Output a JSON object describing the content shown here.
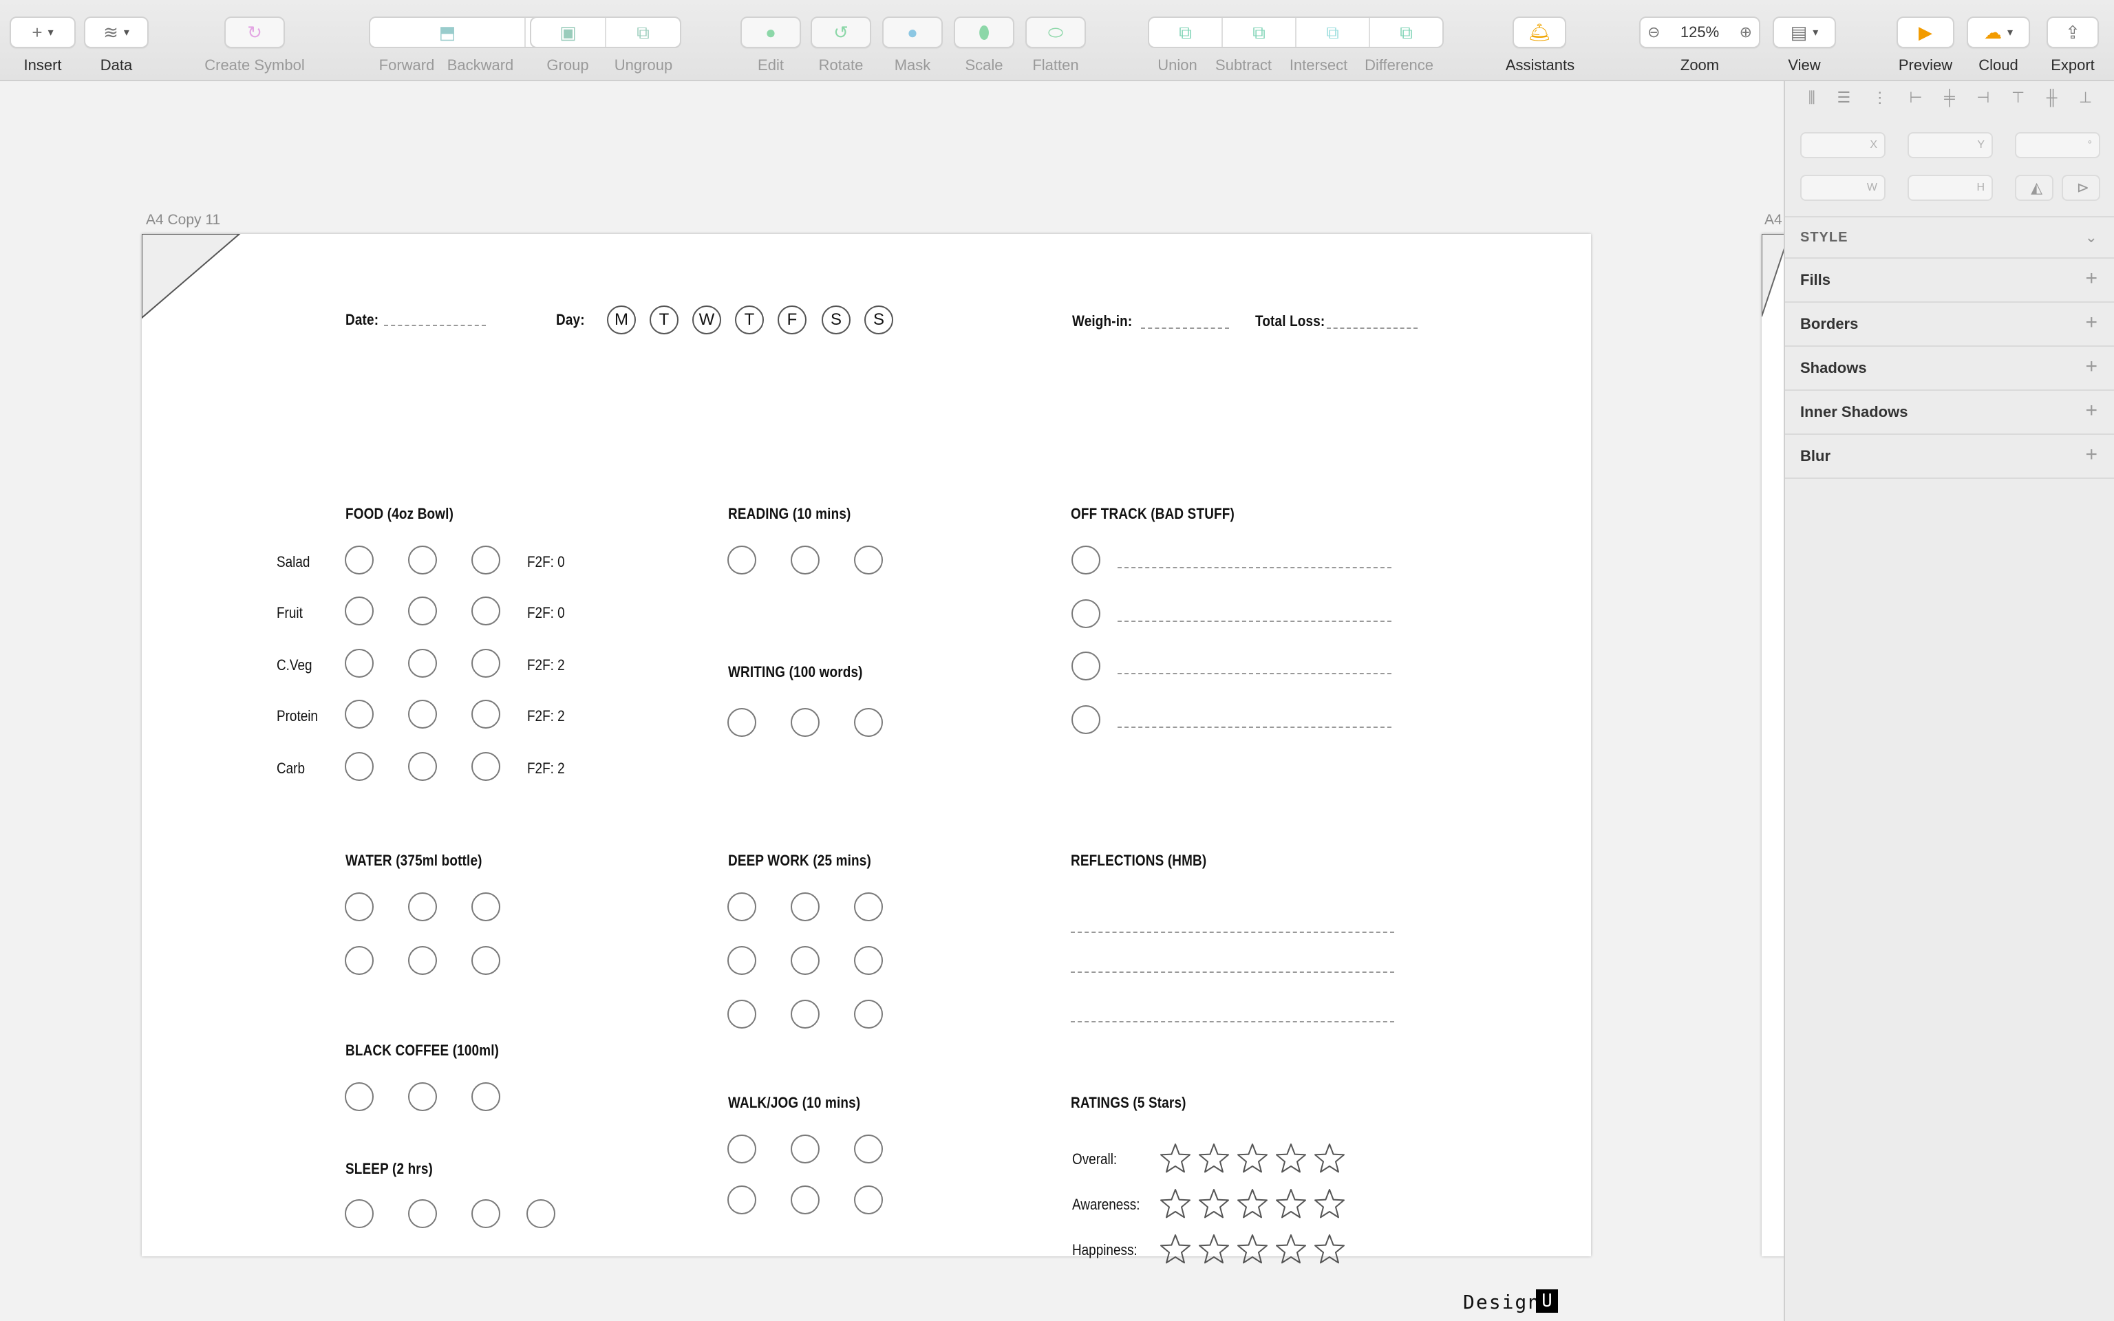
{
  "toolbar": {
    "insert": "Insert",
    "data": "Data",
    "create_symbol": "Create Symbol",
    "forward": "Forward",
    "backward": "Backward",
    "group": "Group",
    "ungroup": "Ungroup",
    "edit": "Edit",
    "rotate": "Rotate",
    "mask": "Mask",
    "scale": "Scale",
    "flatten": "Flatten",
    "union": "Union",
    "subtract": "Subtract",
    "intersect": "Intersect",
    "difference": "Difference",
    "assistants": "Assistants",
    "zoom_value": "125%",
    "zoom": "Zoom",
    "view": "View",
    "preview": "Preview",
    "cloud": "Cloud",
    "export": "Export"
  },
  "canvas": {
    "artboard_label": "A4 Copy 11",
    "artboard2_label": "A4"
  },
  "planner": {
    "date_label": "Date:",
    "day_label": "Day:",
    "days": [
      "M",
      "T",
      "W",
      "T",
      "F",
      "S",
      "S"
    ],
    "weigh_in_label": "Weigh-in:",
    "total_loss_label": "Total Loss:",
    "food": {
      "heading": "FOOD (4oz Bowl)",
      "rows": [
        {
          "name": "Salad",
          "f2f": "F2F: 0"
        },
        {
          "name": "Fruit",
          "f2f": "F2F: 0"
        },
        {
          "name": "C.Veg",
          "f2f": "F2F: 2"
        },
        {
          "name": "Protein",
          "f2f": "F2F: 2"
        },
        {
          "name": "Carb",
          "f2f": "F2F: 2"
        }
      ]
    },
    "reading_heading": "READING (10 mins)",
    "writing_heading": "WRITING (100 words)",
    "off_track_heading": "OFF TRACK (BAD STUFF)",
    "water_heading": "WATER (375ml bottle)",
    "deep_work_heading": "DEEP WORK (25 mins)",
    "reflections_heading": "REFLECTIONS (HMB)",
    "black_coffee_heading": "BLACK COFFEE (100ml)",
    "walk_jog_heading": "WALK/JOG (10 mins)",
    "ratings": {
      "heading": "RATINGS (5 Stars)",
      "rows": [
        "Overall:",
        "Awareness:",
        "Happiness:"
      ]
    },
    "sleep_heading": "SLEEP (2 hrs)",
    "brand": "Design",
    "brand_mark": "U"
  },
  "inspector": {
    "x_label": "X",
    "y_label": "Y",
    "rotation_label": "°",
    "w_label": "W",
    "h_label": "H",
    "style": "STYLE",
    "sections": [
      "Fills",
      "Borders",
      "Shadows",
      "Inner Shadows",
      "Blur"
    ]
  }
}
